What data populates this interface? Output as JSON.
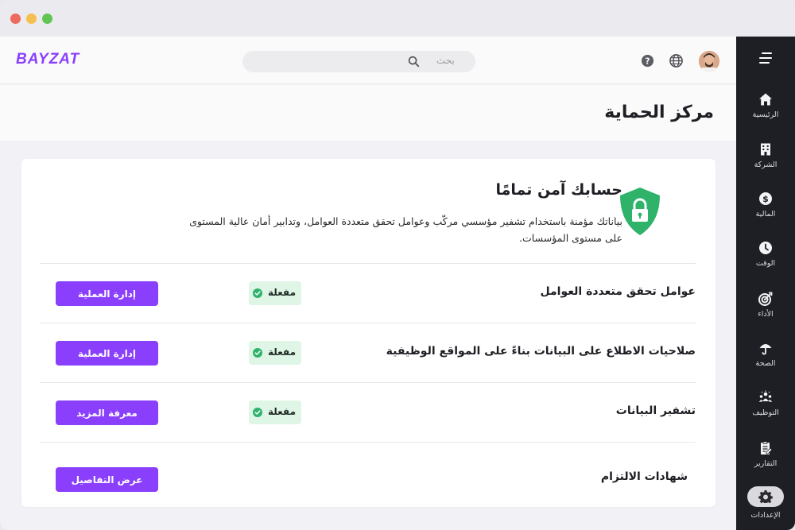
{
  "app": {
    "logo_text": "BAYZAT",
    "accent_color": "#8a3ffc"
  },
  "header": {
    "search": {
      "placeholder": "بحث",
      "icon": "search-icon"
    },
    "help_icon": "help-icon",
    "language_icon": "globe-icon",
    "avatar": "user-avatar"
  },
  "sidebar": {
    "items": [
      {
        "label": "الرئيسية",
        "icon": "home-icon"
      },
      {
        "label": "الشركة",
        "icon": "building-icon"
      },
      {
        "label": "المالية",
        "icon": "dollar-icon"
      },
      {
        "label": "الوقت",
        "icon": "clock-icon"
      },
      {
        "label": "الأداء",
        "icon": "target-icon"
      },
      {
        "label": "الصحة",
        "icon": "umbrella-icon"
      },
      {
        "label": "التوظيف",
        "icon": "people-icon"
      },
      {
        "label": "التقارير",
        "icon": "report-icon"
      },
      {
        "label": "الإعدادات",
        "icon": "gear-icon",
        "active": true
      }
    ]
  },
  "page": {
    "title": "مركز الحماية"
  },
  "security": {
    "title": "حسابك آمن تمامًا",
    "description": "بياناتك مؤمنة باستخدام تشفير مؤسسي مركّب وعوامل تحقق متعددة العوامل، وتدابير أمان عالية المستوى على مستوى المؤسسات.",
    "shield_color": "#2fb36b"
  },
  "rows": [
    {
      "label": "عوامل تحقق متعددة العوامل",
      "status": "مفعلة",
      "action": "إدارة العملية"
    },
    {
      "label": "صلاحيات الاطلاع على البيانات بناءً على المواقع الوظيفية",
      "status": "مفعلة",
      "action": "إدارة العملية"
    },
    {
      "label": "تشفير البيانات",
      "status": "مفعلة",
      "action": "معرفة المزيد"
    },
    {
      "label": "شهادات الالتزام",
      "status": "",
      "action": "عرض التفاصيل"
    }
  ]
}
